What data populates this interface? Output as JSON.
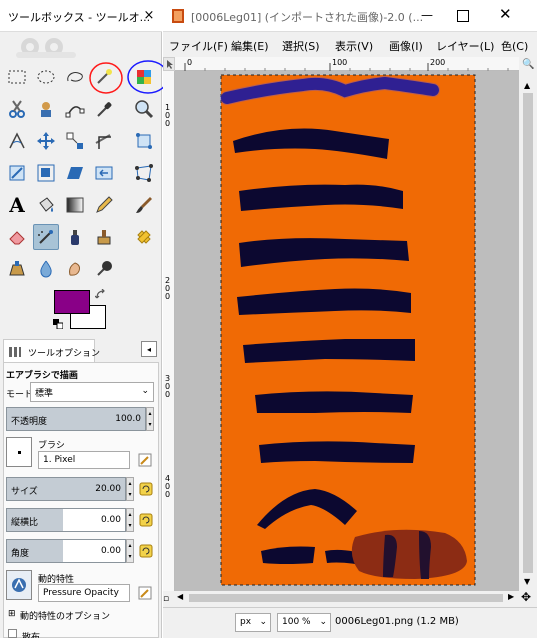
{
  "toolbox": {
    "title": "ツールボックス - ツールオ...",
    "close_glyph": "×",
    "options_tab_label": "ツールオプション",
    "tool_name": "エアブラシで描画",
    "mode_label": "モード:",
    "mode_value": "標準",
    "opacity_label": "不透明度",
    "opacity_value": "100.0",
    "brush_label": "ブラシ",
    "brush_value": "1. Pixel",
    "size_label": "サイズ",
    "size_value": "20.00",
    "aspect_label": "縦横比",
    "aspect_value": "0.00",
    "angle_label": "角度",
    "angle_value": "0.00",
    "dynamics_label": "動的特性",
    "dynamics_value": "Pressure Opacity",
    "dynamics_options_label": "動的特性のオプション",
    "scatter_label": "散布",
    "fg_color": "#890087",
    "bg_color": "#ffffff"
  },
  "image_window": {
    "title": "[0006Leg01] (インポートされた画像)-2.0 (...",
    "menus": [
      "ファイル(F)",
      "編集(E)",
      "選択(S)",
      "表示(V)",
      "画像(I)",
      "レイヤー(L)",
      "色(C)"
    ],
    "ruler_h": [
      "0",
      "100",
      "200"
    ],
    "ruler_v": [
      "1",
      "0",
      "0",
      "2",
      "0",
      "0",
      "3",
      "0",
      "0",
      "4",
      "0",
      "0"
    ],
    "status": {
      "unit": "px",
      "zoom": "100 %",
      "file_info": "0006Leg01.png (1.2 MB)"
    }
  }
}
